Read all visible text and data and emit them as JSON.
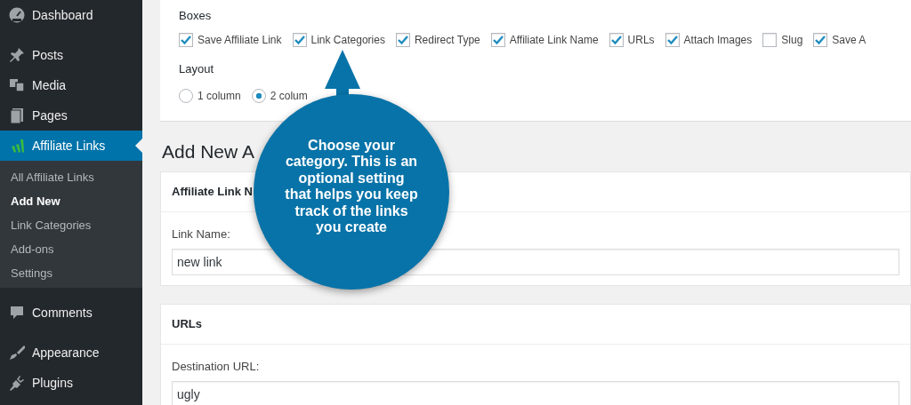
{
  "sidebar": {
    "items": [
      {
        "label": "Dashboard",
        "selected": false
      },
      {
        "label": "Posts",
        "selected": false
      },
      {
        "label": "Media",
        "selected": false
      },
      {
        "label": "Pages",
        "selected": false
      },
      {
        "label": "Affiliate Links",
        "selected": true,
        "children": [
          {
            "label": "All Affiliate Links",
            "selected": false
          },
          {
            "label": "Add New",
            "selected": true
          },
          {
            "label": "Link Categories",
            "selected": false
          },
          {
            "label": "Add-ons",
            "selected": false
          },
          {
            "label": "Settings",
            "selected": false
          }
        ]
      },
      {
        "label": "Comments",
        "selected": false
      },
      {
        "label": "Appearance",
        "selected": false
      },
      {
        "label": "Plugins",
        "selected": false
      }
    ]
  },
  "screen_options": {
    "boxes_title": "Boxes",
    "boxes": [
      {
        "label": "Save Affiliate Link",
        "checked": true
      },
      {
        "label": "Link Categories",
        "checked": true
      },
      {
        "label": "Redirect Type",
        "checked": true
      },
      {
        "label": "Affiliate Link Name",
        "checked": true
      },
      {
        "label": "URLs",
        "checked": true
      },
      {
        "label": "Attach Images",
        "checked": true
      },
      {
        "label": "Slug",
        "checked": false
      },
      {
        "label": "Save A",
        "checked": true
      }
    ],
    "layout_title": "Layout",
    "layouts": [
      {
        "label": "1 column",
        "selected": false
      },
      {
        "label": "2 colum",
        "selected": true
      }
    ]
  },
  "heading": "Add New A",
  "cards": [
    {
      "title": "Affiliate Link N",
      "field_label": "Link Name:",
      "value": "new link"
    },
    {
      "title": "URLs",
      "field_label": "Destination URL:",
      "value": "ugly"
    }
  ],
  "callout": {
    "text": "Choose your category. This is an optional setting that helps you keep track of the links you create"
  }
}
